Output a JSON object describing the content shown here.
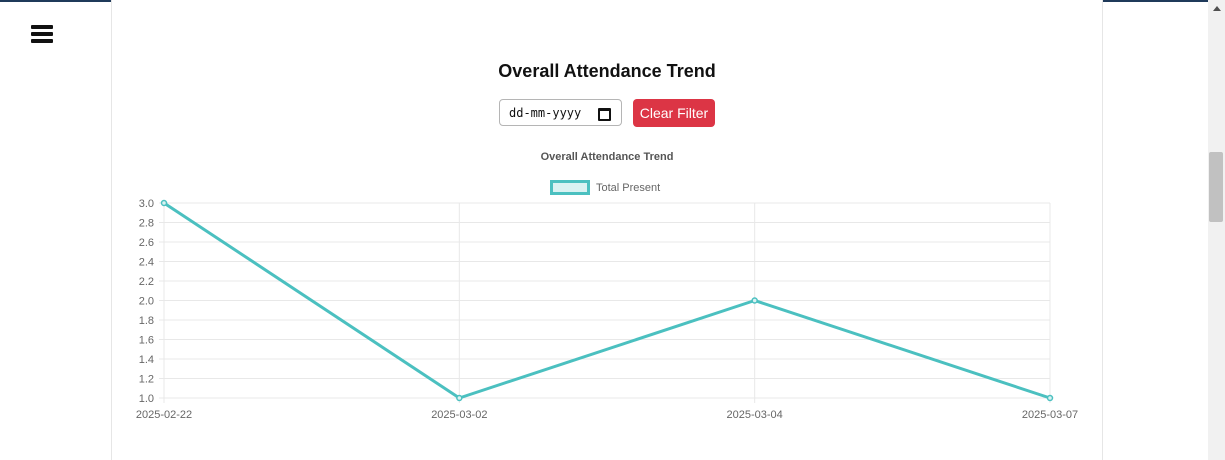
{
  "header": {
    "menu_icon": "hamburger-menu-icon"
  },
  "page": {
    "title": "Overall Attendance Trend"
  },
  "filter": {
    "date_placeholder": "dd-mm-yyyy",
    "calendar_icon": "calendar-icon",
    "clear_label": "Clear Filter"
  },
  "colors": {
    "line": "#4bc0c0",
    "legend_fill": "#d9f2f2",
    "clear_button": "#dc3545",
    "grid": "#e8e8e8"
  },
  "chart_data": {
    "type": "line",
    "title": "Overall Attendance Trend",
    "categories": [
      "2025-02-22",
      "2025-03-02",
      "2025-03-04",
      "2025-03-07"
    ],
    "series": [
      {
        "name": "Total Present",
        "values": [
          3,
          1,
          2,
          1
        ]
      }
    ],
    "ylim": [
      1.0,
      3.0
    ],
    "yticks": [
      "1.0",
      "1.2",
      "1.4",
      "1.6",
      "1.8",
      "2.0",
      "2.2",
      "2.4",
      "2.6",
      "2.8",
      "3.0"
    ],
    "xlabel": "",
    "ylabel": "",
    "legend": "top-center",
    "grid": true
  }
}
